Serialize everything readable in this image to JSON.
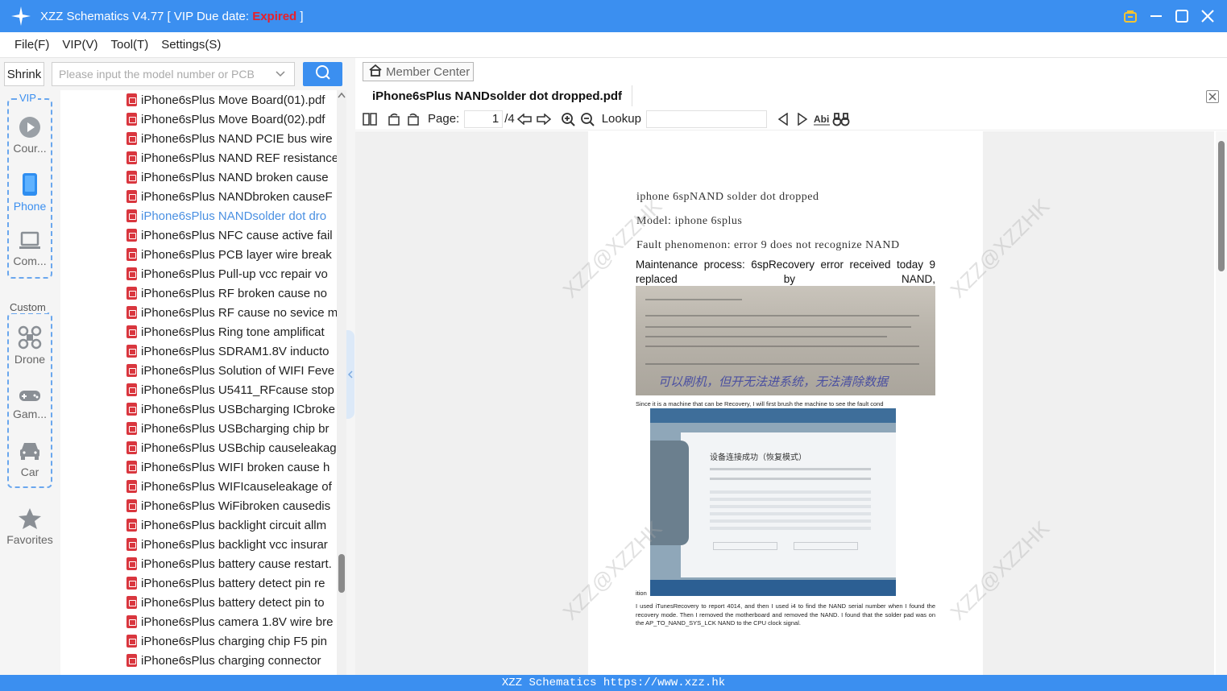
{
  "titlebar": {
    "title_prefix": "XZZ Schematics V4.77 [ VIP Due date: ",
    "expired": "Expired",
    "title_suffix": " ]",
    "icons": [
      "vip-bag-icon",
      "minimize-icon",
      "maximize-icon",
      "close-icon"
    ]
  },
  "menu": [
    "File(F)",
    "VIP(V)",
    "Tool(T)",
    "Settings(S)"
  ],
  "left": {
    "shrink_label": "Shrink",
    "search_placeholder": "Please input the model number or PCB",
    "vip_label": "VIP",
    "custom_label": "Custom",
    "categories_vip": [
      "Cour...",
      "Phone",
      "Com..."
    ],
    "categories_custom": [
      "Drone",
      "Gam...",
      "Car"
    ],
    "favorites": "Favorites"
  },
  "files": [
    "iPhone6sPlus Move Board(01).pdf",
    "iPhone6sPlus Move Board(02).pdf",
    "iPhone6sPlus NAND PCIE bus wire",
    "iPhone6sPlus NAND REF resistance",
    "iPhone6sPlus NAND broken cause",
    "iPhone6sPlus NANDbroken causeF",
    "iPhone6sPlus NANDsolder dot dro",
    "iPhone6sPlus NFC cause active fail",
    "iPhone6sPlus PCB layer wire break",
    "iPhone6sPlus Pull-up vcc repair vo",
    "iPhone6sPlus RF broken cause no",
    "iPhone6sPlus RF cause no sevice m",
    "iPhone6sPlus Ring tone amplificat",
    "iPhone6sPlus SDRAM1.8V inducto",
    "iPhone6sPlus Solution of WIFI Feve",
    "iPhone6sPlus U5411_RFcause stop",
    "iPhone6sPlus USBcharging ICbroke",
    "iPhone6sPlus USBcharging chip br",
    "iPhone6sPlus USBchip causeleakag",
    "iPhone6sPlus WIFI broken cause h",
    "iPhone6sPlus WIFIcauseleakage of",
    "iPhone6sPlus WiFibroken causedis",
    "iPhone6sPlus backlight circuit allm",
    "iPhone6sPlus backlight vcc insurar",
    "iPhone6sPlus battery cause restart.",
    "iPhone6sPlus battery detect pin re",
    "iPhone6sPlus battery detect pin to",
    "iPhone6sPlus camera 1.8V wire bre",
    "iPhone6sPlus charging chip F5 pin",
    "iPhone6sPlus charging connector"
  ],
  "selected_file_index": 6,
  "viewer": {
    "member_center": "Member Center",
    "tab_title": "iPhone6sPlus NANDsolder dot dropped.pdf",
    "page_label": "Page:",
    "page_current": "1",
    "page_total": "/4",
    "lookup_label": "Lookup",
    "doc": {
      "line1": "iphone 6spNAND solder dot dropped",
      "line2": "Model: iphone 6splus",
      "line3": "Fault phenomenon: error 9 does not recognize NAND",
      "para1": "Maintenance process: 6spRecovery error received today 9 replaced by NAND,",
      "caption1": "Since it is a machine that can be Recovery, I will first brush the machine to see the fault cond",
      "caption2": "ition",
      "para2": "I used iTunesRecovery to report 4014, and then I used i4 to find the NAND serial number when I found the recovery mode. Then I removed the motherboard and removed the NAND. I found that the solder pad was on the AP_TO_NAND_SYS_LCK NAND to the CPU clock signal.",
      "photo1_text": "可以刷机，但开无法进系统，无法清除数据",
      "photo2_title": "设备连接成功（恢复模式）",
      "watermark": "XZZ@XZZHK"
    }
  },
  "statusbar": "XZZ Schematics https://www.xzz.hk",
  "colors": {
    "accent": "#3b8ff0",
    "expired": "#e8202a",
    "selected_file": "#4a90e2",
    "pdf_icon": "#d9363e"
  }
}
